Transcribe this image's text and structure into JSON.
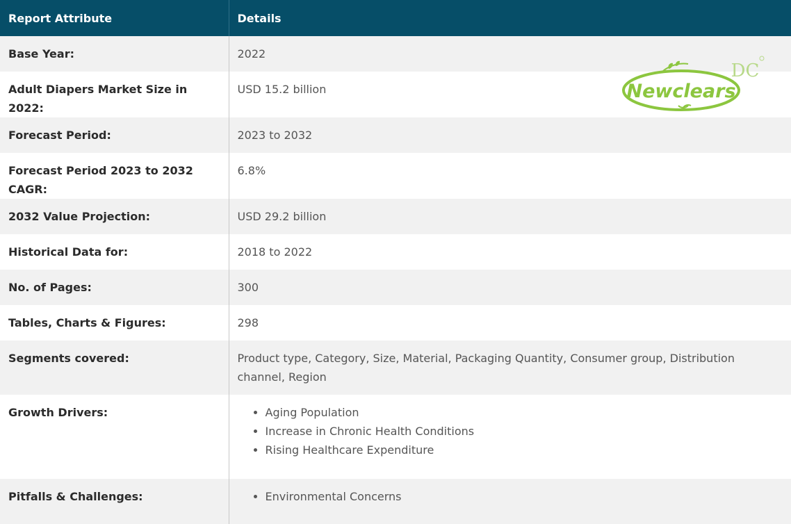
{
  "header": {
    "attribute_label": "Report Attribute",
    "details_label": "Details"
  },
  "rows": [
    {
      "attribute": "Base Year:",
      "detail": "2022"
    },
    {
      "attribute": "Adult Diapers Market Size in 2022:",
      "detail": "USD 15.2 billion"
    },
    {
      "attribute": "Forecast Period:",
      "detail": "2023 to 2032"
    },
    {
      "attribute": "Forecast Period 2023 to 2032 CAGR:",
      "detail": "6.8%"
    },
    {
      "attribute": "2032 Value Projection:",
      "detail": "USD 29.2 billion"
    },
    {
      "attribute": "Historical Data for:",
      "detail": "2018 to 2022"
    },
    {
      "attribute": "No. of Pages:",
      "detail": "300"
    },
    {
      "attribute": "Tables, Charts & Figures:",
      "detail": "298"
    },
    {
      "attribute": "Segments covered:",
      "detail": "Product type, Category, Size, Material, Packaging Quantity, Consumer group, Distribution channel, Region"
    },
    {
      "attribute": "Growth Drivers:",
      "items": [
        "Aging Population",
        "Increase in Chronic Health Conditions",
        "Rising Healthcare Expenditure"
      ]
    },
    {
      "attribute": "Pitfalls & Challenges:",
      "items": [
        "Environmental Concerns"
      ]
    }
  ],
  "logo": {
    "text": "Newclears",
    "mark": "DC",
    "color": "#8cc63f"
  }
}
